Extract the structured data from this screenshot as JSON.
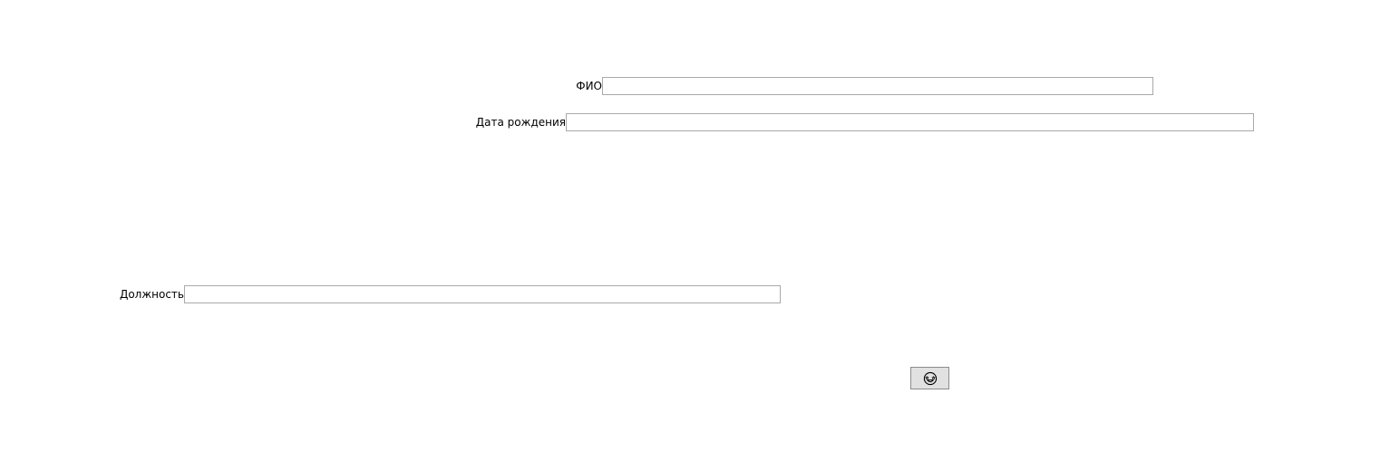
{
  "form": {
    "fio": {
      "label": "ФИО",
      "value": "",
      "placeholder": ""
    },
    "birth_date": {
      "label": "Дата рождения",
      "value": "",
      "placeholder": ""
    },
    "position": {
      "label": "Должность",
      "value": "",
      "placeholder": ""
    },
    "submit_button": {
      "icon": "grinning-face-with-star-eyes-icon"
    }
  },
  "colors": {
    "background": "#ffffff",
    "field_border": "#a9a9a9",
    "button_face": "#e1e1e1",
    "button_border": "#8c8c8c"
  }
}
